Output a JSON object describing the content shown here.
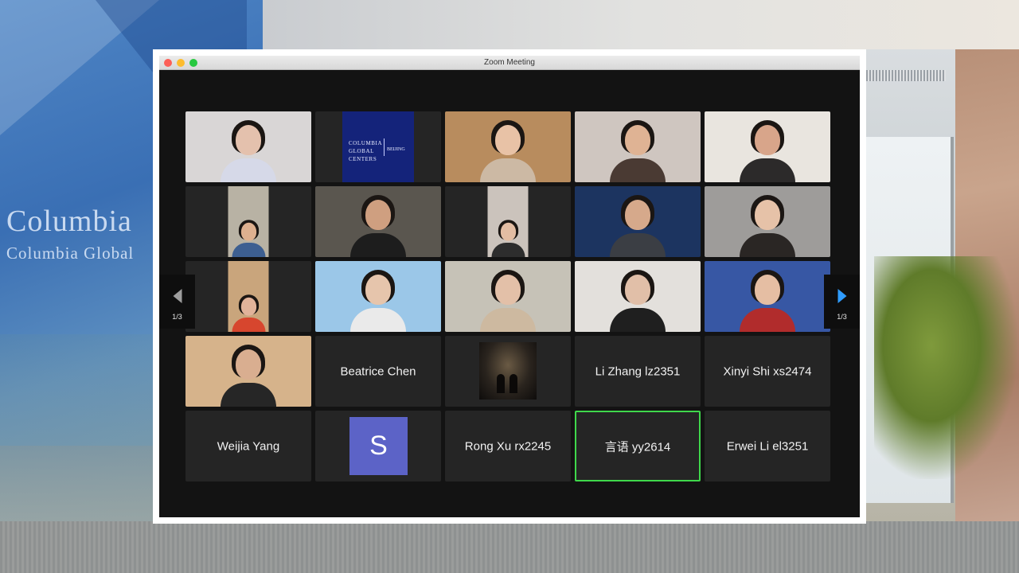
{
  "window": {
    "title": "Zoom Meeting"
  },
  "backdrop": {
    "wall_text_1": "Columbia",
    "wall_text_2": "Columbia Global"
  },
  "pagination": {
    "left_label": "1/3",
    "right_label": "1/3"
  },
  "tiles": [
    {
      "type": "video",
      "skin": "#e4c1ad",
      "bg": "#d9d6d6",
      "shirt": "#d6d9e8"
    },
    {
      "type": "logo",
      "lines": [
        "Columbia",
        "Global",
        "Centers"
      ],
      "city": "Beijing"
    },
    {
      "type": "video",
      "skin": "#e8c2a6",
      "bg": "#b88c5e",
      "shirt": "#ccb9a4"
    },
    {
      "type": "video",
      "skin": "#dfb394",
      "bg": "#cfc6c0",
      "shirt": "#4a3a33"
    },
    {
      "type": "video",
      "skin": "#d8a58a",
      "bg": "#e9e5df",
      "shirt": "#2c2a2a"
    },
    {
      "type": "video-small",
      "skin": "#deb08f",
      "bg": "#b8b2a4",
      "shirt": "#3d5f91"
    },
    {
      "type": "video",
      "skin": "#cf9f80",
      "bg": "#5a564f",
      "shirt": "#1d1d1d"
    },
    {
      "type": "video-small",
      "skin": "#e3bda3",
      "bg": "#cbc3bc",
      "shirt": "#2d2d2d"
    },
    {
      "type": "video",
      "skin": "#d6a98b",
      "bg": "#1c3460",
      "shirt": "#3b3e44"
    },
    {
      "type": "video",
      "skin": "#e6c2a8",
      "bg": "#9e9c9a",
      "shirt": "#2a2624"
    },
    {
      "type": "video-small",
      "skin": "#e1b39a",
      "bg": "#c9a57c",
      "shirt": "#d7462e"
    },
    {
      "type": "video",
      "skin": "#e6c5ac",
      "bg": "#9bc7e8",
      "shirt": "#eaeaea"
    },
    {
      "type": "video",
      "skin": "#e3c0a8",
      "bg": "#c6c2b7",
      "shirt": "#cdb9a0"
    },
    {
      "type": "video",
      "skin": "#e1bfa8",
      "bg": "#e3e0dc",
      "shirt": "#1f1f1f"
    },
    {
      "type": "video",
      "skin": "#e5bea3",
      "bg": "#3757a4",
      "shirt": "#b12c2c"
    },
    {
      "type": "video",
      "skin": "#d9ae90",
      "bg": "#d6b38b",
      "shirt": "#262626"
    },
    {
      "type": "name",
      "name": "Beatrice Chen"
    },
    {
      "type": "poster"
    },
    {
      "type": "name",
      "name": "Li Zhang lz2351"
    },
    {
      "type": "name",
      "name": "Xinyi Shi xs2474"
    },
    {
      "type": "name",
      "name": "Weijia Yang"
    },
    {
      "type": "avatar",
      "initial": "S",
      "color": "#5c63c7"
    },
    {
      "type": "name",
      "name": "Rong Xu rx2245"
    },
    {
      "type": "name",
      "name": "言语 yy2614",
      "active": true
    },
    {
      "type": "name",
      "name": "Erwei Li el3251"
    }
  ],
  "colors": {
    "active_speaker_border": "#3fd84b",
    "tile_background": "#252525",
    "window_background": "#131313",
    "next_arrow": "#2f9cff"
  }
}
